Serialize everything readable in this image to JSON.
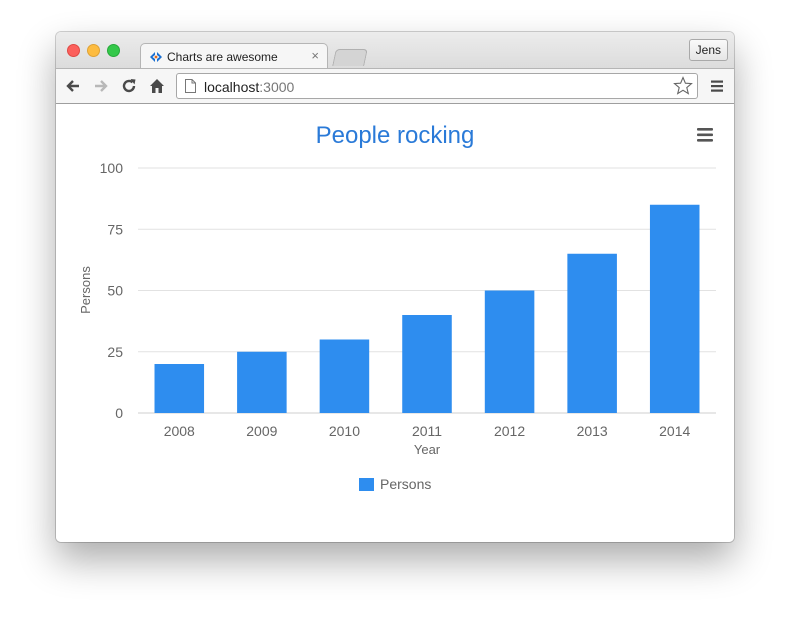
{
  "browser": {
    "tab_title": "Charts are awesome",
    "tab_close": "×",
    "profile_name": "Jens",
    "url_host": "localhost",
    "url_port": ":3000",
    "icons": {
      "back": "arrow-left-icon",
      "forward": "arrow-right-icon",
      "reload": "reload-icon",
      "home": "home-icon",
      "page": "page-icon",
      "bookmark": "star-icon",
      "menu": "hamburger-menu-icon",
      "favicon": "kendo-favicon-icon"
    }
  },
  "chart_data": {
    "type": "bar",
    "title": "People rocking",
    "xlabel": "Year",
    "ylabel": "Persons",
    "categories": [
      "2008",
      "2009",
      "2010",
      "2011",
      "2012",
      "2013",
      "2014"
    ],
    "series": [
      {
        "name": "Persons",
        "values": [
          20,
          25,
          30,
          40,
          50,
          65,
          85
        ]
      }
    ],
    "ylim": [
      0,
      100
    ],
    "yticks": [
      "0",
      "25",
      "50",
      "75",
      "100"
    ],
    "ytick_values": [
      0,
      25,
      50,
      75,
      100
    ],
    "grid": true,
    "legend_position": "bottom",
    "colors": {
      "bar": "#2e8def",
      "title": "#2a7ad8",
      "grid": "#e2e2e2",
      "text": "#666666"
    },
    "menu_icon": "hamburger-menu-icon"
  }
}
